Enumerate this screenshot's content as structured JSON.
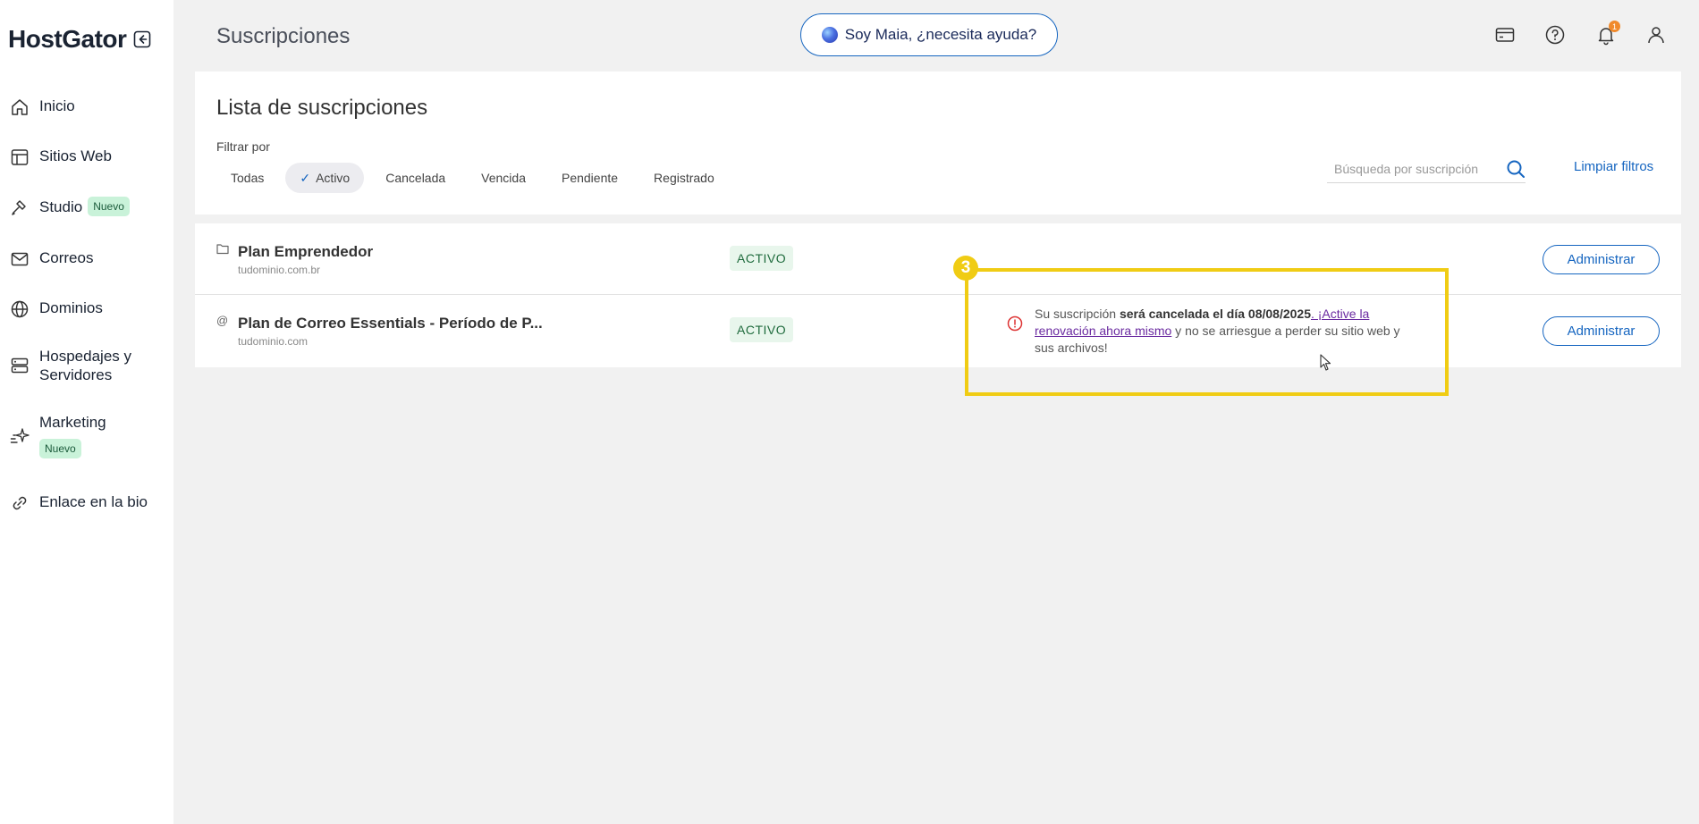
{
  "sidebar": {
    "logo": "HostGator",
    "items": [
      {
        "label": "Inicio"
      },
      {
        "label": "Sitios Web"
      },
      {
        "label": "Studio",
        "badge": "Nuevo"
      },
      {
        "label": "Correos"
      },
      {
        "label": "Dominios"
      },
      {
        "label": "Hospedajes y Servidores"
      },
      {
        "label": "Marketing",
        "badge": "Nuevo"
      },
      {
        "label": "Enlace en la bio"
      }
    ]
  },
  "header": {
    "title": "Suscripciones",
    "assistant_label": "Soy Maia, ¿necesita ayuda?",
    "notification_count": "1"
  },
  "filters": {
    "card_title": "Lista de suscripciones",
    "filter_label": "Filtrar por",
    "chips": [
      "Todas",
      "Activo",
      "Cancelada",
      "Vencida",
      "Pendiente",
      "Registrado"
    ],
    "active_chip": "Activo",
    "search_placeholder": "Búsqueda por suscripción",
    "clear_label": "Limpiar filtros"
  },
  "subscriptions": [
    {
      "name": "Plan Emprendedor",
      "domain": "tudominio.com.br",
      "status": "ACTIVO",
      "action": "Administrar",
      "icon": "folder-icon"
    },
    {
      "name": "Plan de Correo Essentials - Período de P...",
      "domain": "tudominio.com",
      "status": "ACTIVO",
      "action": "Administrar",
      "icon": "at-icon",
      "warning": {
        "prefix": "Su suscripción ",
        "bold": "será cancelada el día 08/08/2025",
        "link": ". ¡Active la renovación ahora mismo",
        "suffix": " y no se arriesgue a perder su sitio web y sus archivos!"
      }
    }
  ],
  "annotation": {
    "number": "3",
    "color": "#f0cc14"
  },
  "colors": {
    "accent": "#1565c0",
    "badge_green": "#c9f2d9",
    "status_bg": "#e8f6ec"
  }
}
